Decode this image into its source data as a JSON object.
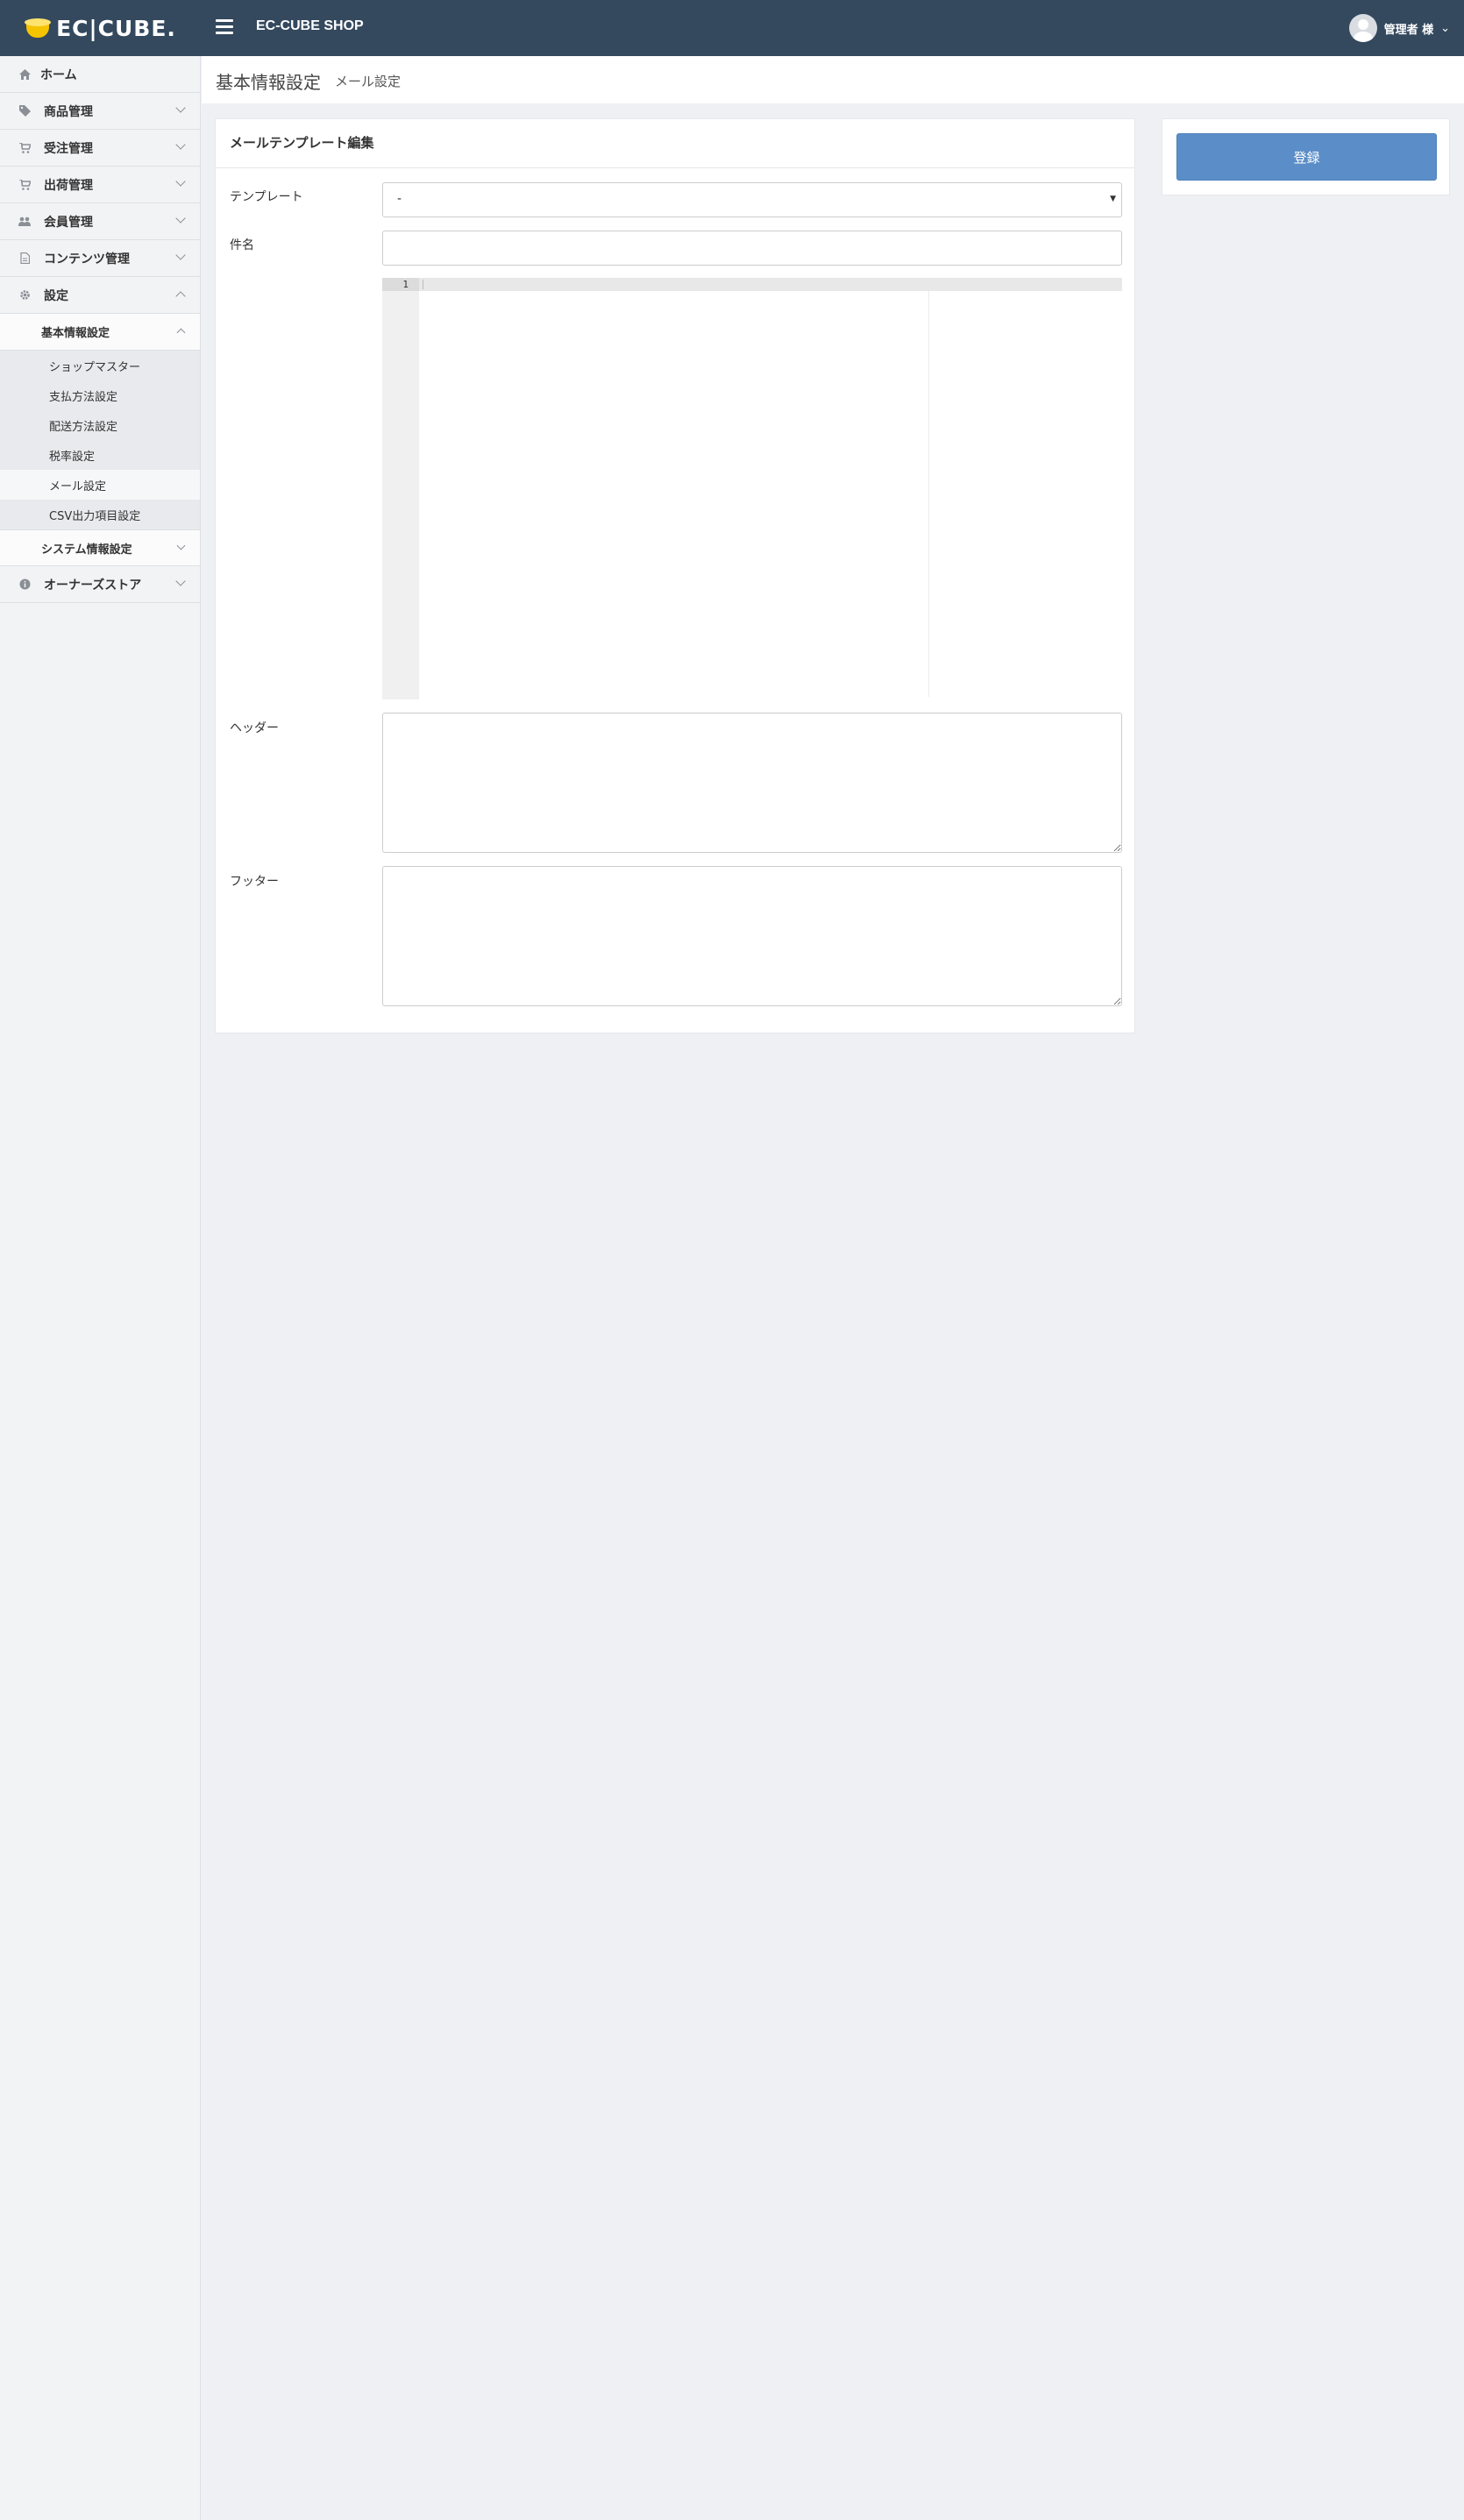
{
  "header": {
    "logo_text": "EC|CUBE.",
    "shop_name": "EC-CUBE SHOP",
    "user_name": "管理者 様"
  },
  "sidebar": {
    "items": [
      {
        "label": "ホーム",
        "icon": "home-icon"
      },
      {
        "label": "商品管理",
        "icon": "tag-icon"
      },
      {
        "label": "受注管理",
        "icon": "cart-icon"
      },
      {
        "label": "出荷管理",
        "icon": "cart-icon"
      },
      {
        "label": "会員管理",
        "icon": "users-icon"
      },
      {
        "label": "コンテンツ管理",
        "icon": "file-icon"
      },
      {
        "label": "設定",
        "icon": "gear-icon"
      }
    ],
    "settings_sub": {
      "basic_label": "基本情報設定",
      "basic_children": [
        "ショップマスター",
        "支払方法設定",
        "配送方法設定",
        "税率設定",
        "メール設定",
        "CSV出力項目設定"
      ],
      "system_label": "システム情報設定"
    },
    "owners_store": {
      "label": "オーナーズストア",
      "icon": "info-icon"
    }
  },
  "titlebar": {
    "title": "基本情報設定",
    "subtitle": "メール設定"
  },
  "card": {
    "header": "メールテンプレート編集",
    "template_label": "テンプレート",
    "template_value": "-",
    "subject_label": "件名",
    "subject_value": "",
    "editor_line_number": "1",
    "header_label": "ヘッダー",
    "footer_label": "フッター"
  },
  "actions": {
    "register_label": "登録"
  },
  "colors": {
    "topbar": "#34495e",
    "primary_button": "#5b8ec8",
    "background": "#eef0f4"
  }
}
